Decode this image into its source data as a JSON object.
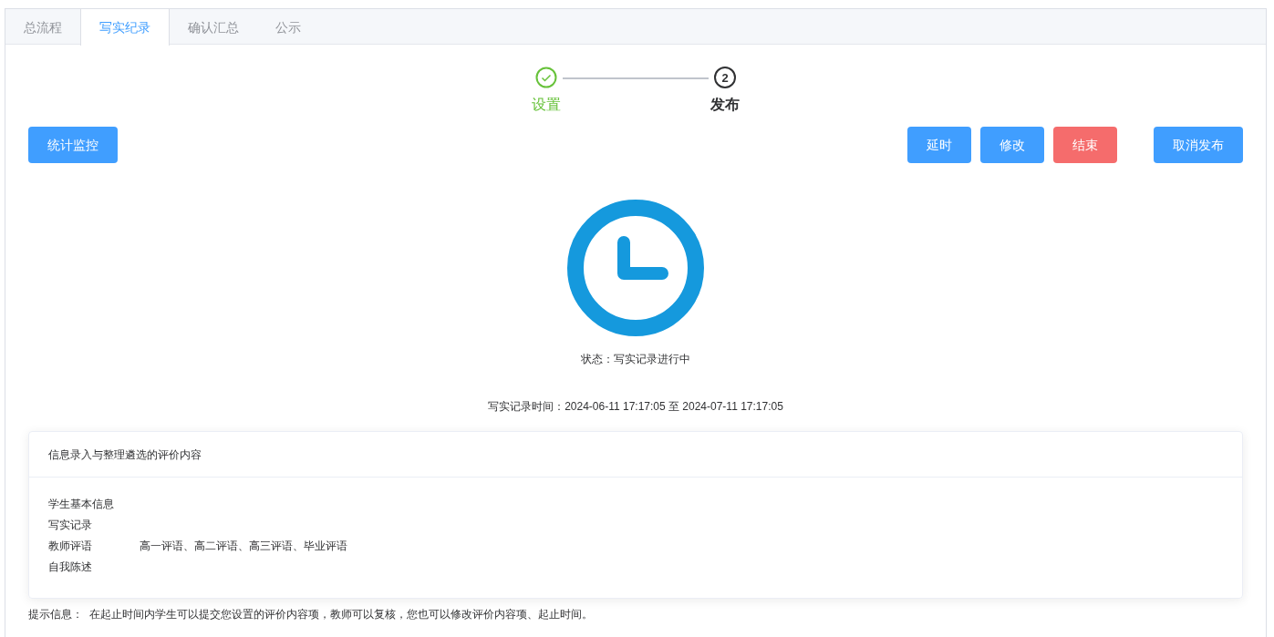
{
  "tabs": [
    {
      "label": "总流程",
      "selected": false
    },
    {
      "label": "写实纪录",
      "selected": true
    },
    {
      "label": "确认汇总",
      "selected": false
    },
    {
      "label": "公示",
      "selected": false
    }
  ],
  "steps": [
    {
      "label": "设置",
      "done": true
    },
    {
      "number": "2",
      "label": "发布",
      "done": false
    }
  ],
  "left_button": {
    "label": "统计监控",
    "kind": "primary"
  },
  "action_buttons": [
    {
      "label": "延时",
      "kind": "primary"
    },
    {
      "label": "修改",
      "kind": "primary"
    },
    {
      "label": "结束",
      "kind": "danger"
    }
  ],
  "cancel_button": {
    "label": "取消发布",
    "kind": "primary"
  },
  "status_text": "状态：写实记录进行中",
  "time_text": "写实记录时间：2024-06-11 17:17:05 至 2024-07-11 17:17:05",
  "card": {
    "title": "信息录入与整理遴选的评价内容",
    "items": [
      {
        "name": "学生基本信息"
      },
      {
        "name": "写实记录"
      },
      {
        "name": "教师评语",
        "detail": "高一评语、高二评语、高三评语、毕业评语"
      },
      {
        "name": "自我陈述"
      }
    ]
  },
  "tip": "提示信息：  在起止时间内学生可以提交您设置的评价内容项，教师可以复核，您也可以修改评价内容项、起止时间。"
}
